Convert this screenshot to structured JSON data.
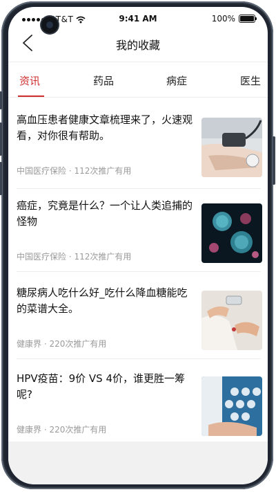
{
  "status_bar": {
    "carrier": "AT&T",
    "time": "9:41 AM",
    "battery": "100%"
  },
  "nav": {
    "title": "我的收藏"
  },
  "tabs": [
    {
      "label": "资讯",
      "active": true
    },
    {
      "label": "药品",
      "active": false
    },
    {
      "label": "病症",
      "active": false
    },
    {
      "label": "医生",
      "active": false
    }
  ],
  "articles": [
    {
      "title": "高血压患者健康文章梳理来了，火速观看，对你很有帮助。",
      "meta": "中国医疗保险 · 112次推广有用",
      "thumb": "blood-pressure-measurement-icon"
    },
    {
      "title": "癌症，究竟是什么？一个让人类追捕的怪物",
      "meta": "中国医疗保险 · 112次推广有用",
      "thumb": "cancer-cells-icon"
    },
    {
      "title": "糖尿病人吃什么好_吃什么降血糖能吃的菜谱大全。",
      "meta": "健康界 · 220次推广有用",
      "thumb": "glucose-test-icon"
    },
    {
      "title": "HPV疫苗：9价 VS 4价，谁更胜一筹呢?",
      "meta": "健康界 · 220次推广有用",
      "thumb": "medical-technology-icon"
    }
  ],
  "colors": {
    "accent": "#cf2d2d",
    "meta_text": "#9a9a9a",
    "divider": "#ededed"
  }
}
